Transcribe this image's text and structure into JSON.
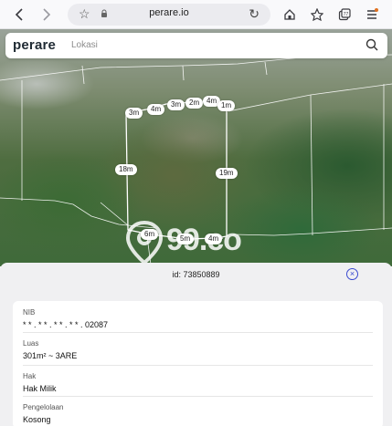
{
  "browser": {
    "url": "perare.io"
  },
  "search": {
    "brand": "perare",
    "placeholder": "Lokasi"
  },
  "map": {
    "measurements": [
      "3m",
      "4m",
      "3m",
      "2m",
      "4m",
      "1m",
      "18m",
      "19m",
      "6m",
      "5m",
      "4m"
    ],
    "watermark": "99.co"
  },
  "sheet": {
    "id_text": "id: 73850889",
    "fields": [
      {
        "label": "NIB",
        "value": "* * . * * . * * . * * . 02087"
      },
      {
        "label": "Luas",
        "value": "301m² ~ 3ARE"
      },
      {
        "label": "Hak",
        "value": "Hak Milik"
      },
      {
        "label": "Pengelolaan",
        "value": "Kosong"
      }
    ]
  }
}
